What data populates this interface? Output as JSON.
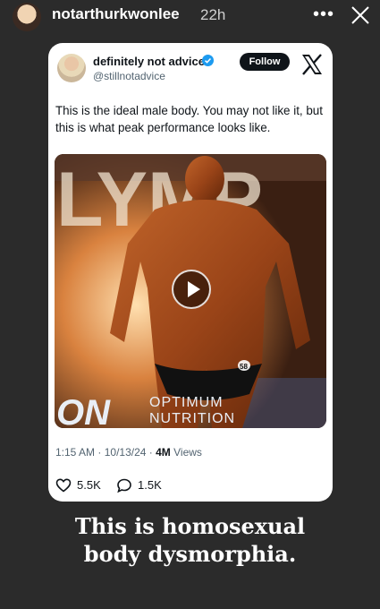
{
  "story": {
    "username": "notarthurkwonlee",
    "time": "22h",
    "more_icon": "more-horizontal-icon",
    "close_icon": "close-icon"
  },
  "tweet": {
    "display_name": "definitely not advice",
    "handle": "@stillnotadvice",
    "follow_label": "Follow",
    "text": "This is the ideal male body. You may not like it, but this is what peak performance looks like.",
    "media_overlay": {
      "badge_number": "58",
      "logo_left": "ON",
      "logo_text_line1": "OPTIMUM",
      "logo_text_line2": "NUTRITION",
      "banner_letters": "LYMP"
    },
    "time": "1:15 AM",
    "date": "10/13/24",
    "views_count": "4M",
    "views_label": "Views",
    "likes": "5.5K",
    "replies": "1.5K"
  },
  "caption": {
    "line1": "This is homosexual",
    "line2": "body dysmorphia."
  },
  "colors": {
    "background": "#2b2b2b",
    "card": "#ffffff",
    "verified": "#1d9bf0",
    "text_dark": "#0f1419",
    "text_muted": "#536471"
  }
}
